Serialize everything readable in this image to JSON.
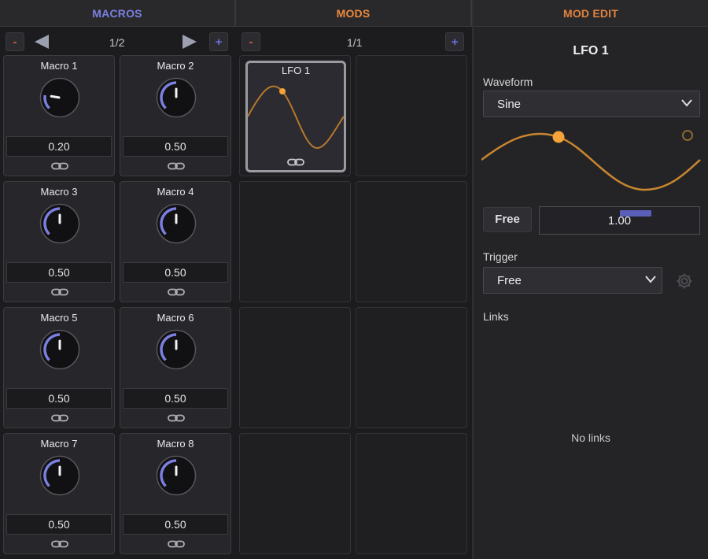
{
  "macros": {
    "header": "MACROS",
    "page": "1/2",
    "minus_label": "-",
    "plus_label": "+",
    "items": [
      {
        "name": "Macro 1",
        "value": "0.20",
        "level": 0.2
      },
      {
        "name": "Macro 2",
        "value": "0.50",
        "level": 0.5
      },
      {
        "name": "Macro 3",
        "value": "0.50",
        "level": 0.5
      },
      {
        "name": "Macro 4",
        "value": "0.50",
        "level": 0.5
      },
      {
        "name": "Macro 5",
        "value": "0.50",
        "level": 0.5
      },
      {
        "name": "Macro 6",
        "value": "0.50",
        "level": 0.5
      },
      {
        "name": "Macro 7",
        "value": "0.50",
        "level": 0.5
      },
      {
        "name": "Macro 8",
        "value": "0.50",
        "level": 0.5
      }
    ]
  },
  "mods": {
    "header": "MODS",
    "page": "1/1",
    "minus_label": "-",
    "plus_label": "+",
    "lfo_card": {
      "name": "LFO 1"
    }
  },
  "mod_edit": {
    "header": "MOD EDIT",
    "title": "LFO 1",
    "waveform_label": "Waveform",
    "waveform_value": "Sine",
    "sync_mode": "Free",
    "rate_value": "1.00",
    "trigger_label": "Trigger",
    "trigger_value": "Free",
    "links_label": "Links",
    "links_empty": "No links"
  },
  "colors": {
    "macro_accent": "#7b7fe0",
    "mod_accent": "#f0883a",
    "waveform": "#c8862e",
    "lfo_dot": "#f5a33a"
  },
  "icons": [
    "chevron-left-icon",
    "chevron-right-icon",
    "link-icon",
    "chevron-down-icon",
    "gear-icon"
  ]
}
